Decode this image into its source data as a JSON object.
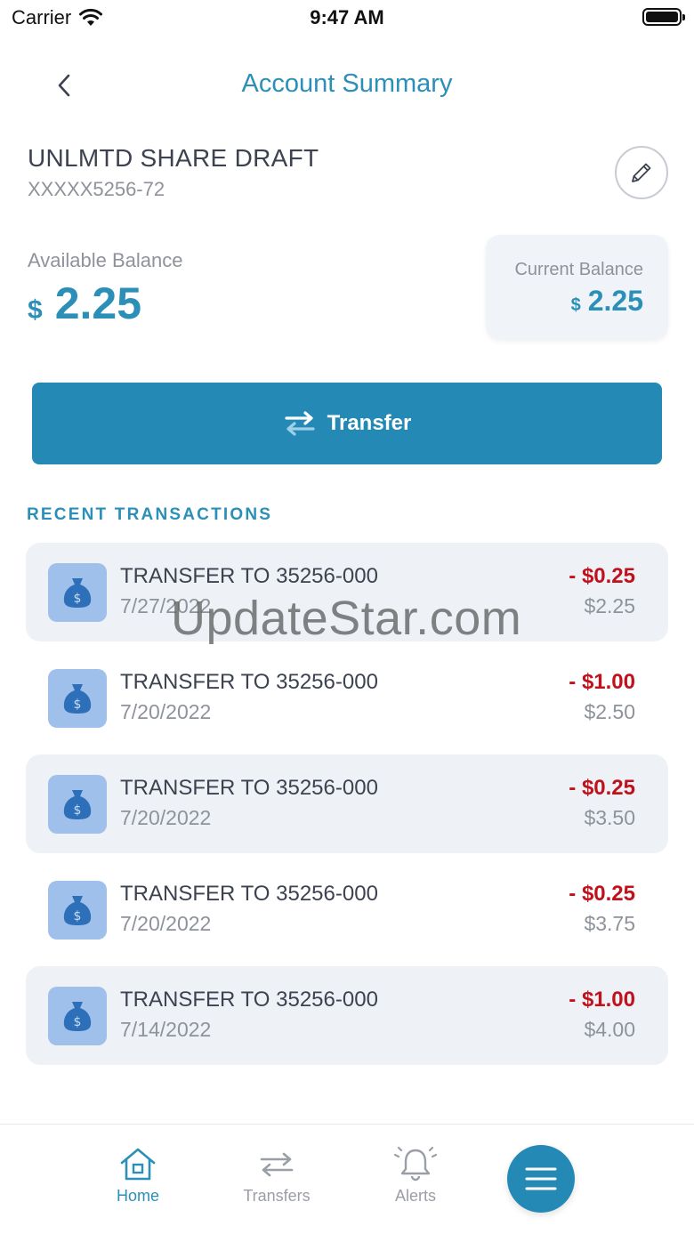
{
  "status_bar": {
    "carrier": "Carrier",
    "time": "9:47 AM"
  },
  "nav": {
    "title": "Account Summary",
    "back_icon": "chevron-left-icon"
  },
  "account": {
    "name": "UNLMTD SHARE DRAFT",
    "number": "XXXXX5256-72",
    "edit_icon": "pencil-icon"
  },
  "balances": {
    "available_label": "Available Balance",
    "available_currency": "$",
    "available_value": "2.25",
    "current_label": "Current Balance",
    "current_currency": "$",
    "current_value": "2.25"
  },
  "transfer_button": {
    "label": "Transfer",
    "icon": "transfer-arrows-icon"
  },
  "recent": {
    "title": "RECENT TRANSACTIONS",
    "items": [
      {
        "description": "TRANSFER TO 35256-000",
        "date": "7/27/2022",
        "amount": "- $0.25",
        "balance": "$2.25"
      },
      {
        "description": "TRANSFER TO 35256-000",
        "date": "7/20/2022",
        "amount": "- $1.00",
        "balance": "$2.50"
      },
      {
        "description": "TRANSFER TO 35256-000",
        "date": "7/20/2022",
        "amount": "- $0.25",
        "balance": "$3.50"
      },
      {
        "description": "TRANSFER TO 35256-000",
        "date": "7/20/2022",
        "amount": "- $0.25",
        "balance": "$3.75"
      },
      {
        "description": "TRANSFER TO 35256-000",
        "date": "7/14/2022",
        "amount": "- $1.00",
        "balance": "$4.00"
      }
    ]
  },
  "watermark": "UpdateStar.com",
  "tab_bar": {
    "home": "Home",
    "transfers": "Transfers",
    "alerts": "Alerts",
    "menu_icon": "hamburger-menu-icon"
  },
  "colors": {
    "accent": "#2b8fb8",
    "button": "#2589b6",
    "negative": "#c0121c",
    "muted": "#8e929b",
    "card": "#eef2f7"
  }
}
